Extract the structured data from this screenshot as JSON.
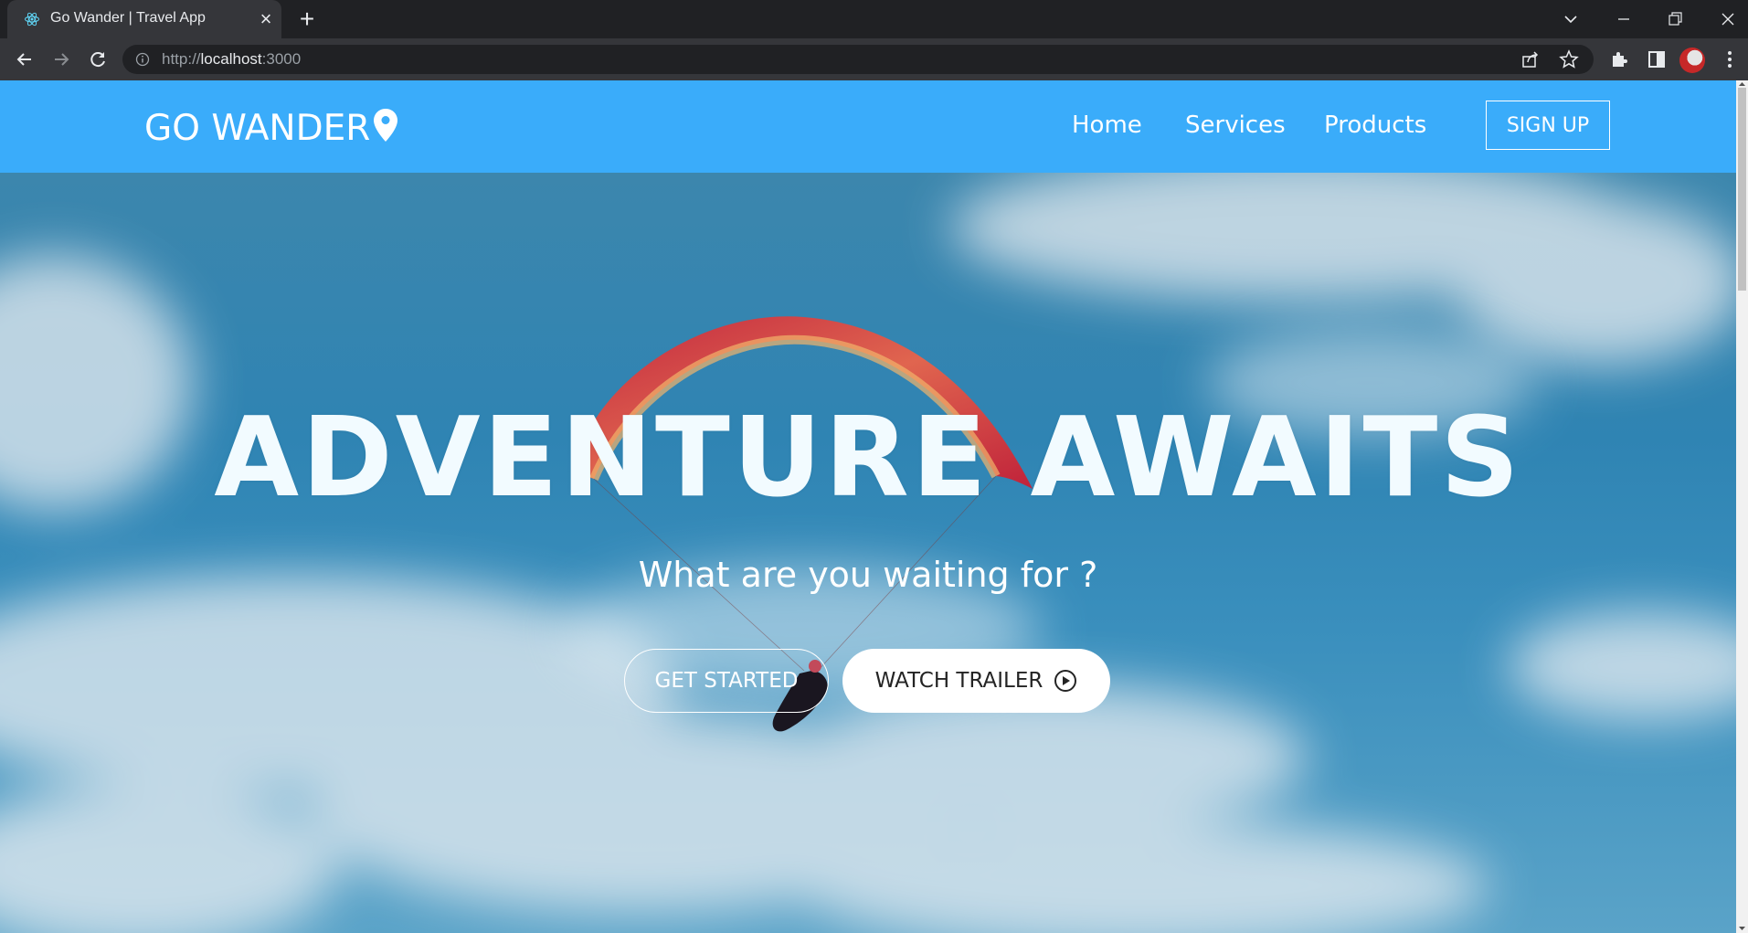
{
  "browser": {
    "tab_title": "Go Wander | Travel App",
    "url_prefix": "http://",
    "url_host": "localhost",
    "url_port": ":3000"
  },
  "navbar": {
    "logo": "GO WANDER",
    "links": [
      "Home",
      "Services",
      "Products"
    ],
    "signup_label": "SIGN UP",
    "background_color": "#3aacfa"
  },
  "hero": {
    "title": "ADVENTURE AWAITS",
    "subtitle": "What are you waiting for ?",
    "primary_button": "GET STARTED",
    "secondary_button": "WATCH TRAILER",
    "secondary_button_icon": "play-circle-icon"
  }
}
